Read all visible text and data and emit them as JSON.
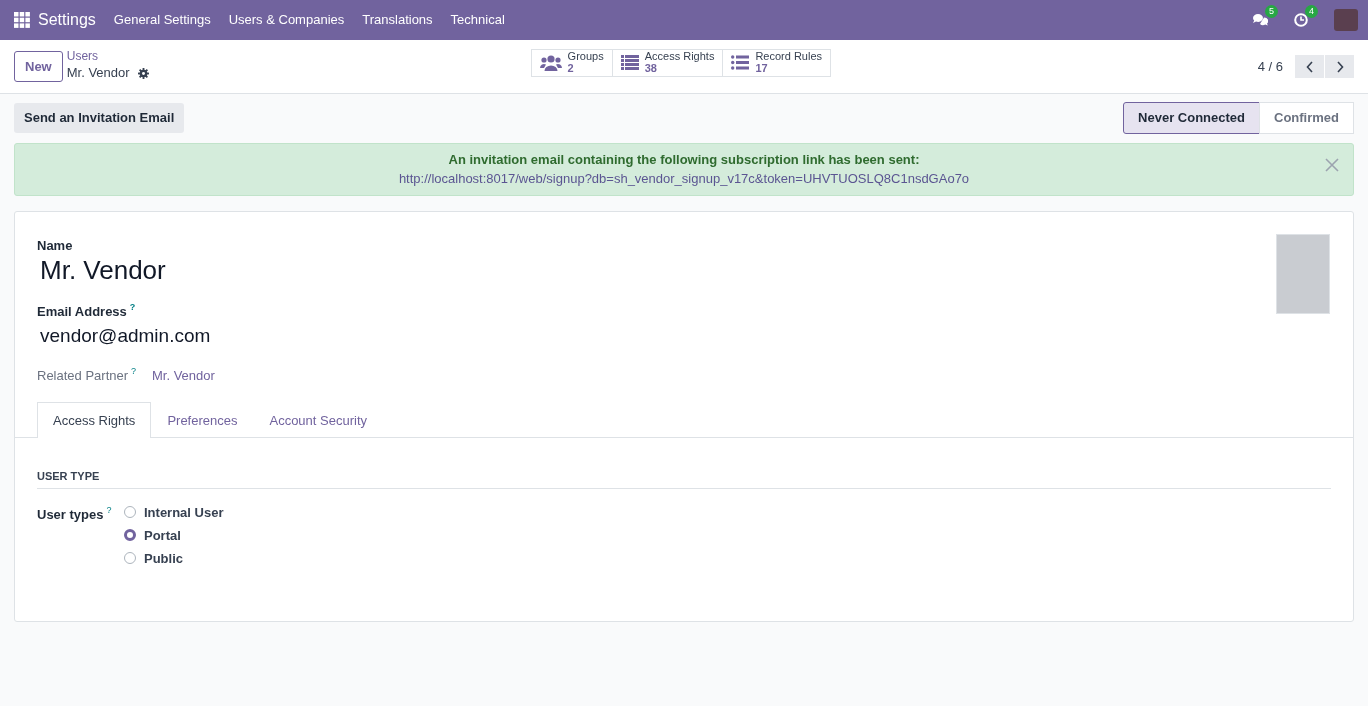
{
  "navbar": {
    "app_title": "Settings",
    "menu": [
      "General Settings",
      "Users & Companies",
      "Translations",
      "Technical"
    ],
    "messages_badge": "5",
    "activities_badge": "4"
  },
  "control_panel": {
    "new_button": "New",
    "breadcrumb": "Users",
    "record_title": "Mr. Vendor",
    "smart_buttons": [
      {
        "kind": "users",
        "label": "Groups",
        "value": "2"
      },
      {
        "kind": "list",
        "label": "Access Rights",
        "value": "38"
      },
      {
        "kind": "bullets",
        "label": "Record Rules",
        "value": "17"
      }
    ],
    "pager": "4 / 6"
  },
  "header": {
    "action_button": "Send an Invitation Email",
    "stages": [
      {
        "label": "Never Connected",
        "selected": true
      },
      {
        "label": "Confirmed",
        "selected": false
      }
    ]
  },
  "alert": {
    "title": "An invitation email containing the following subscription link has been sent:",
    "link": "http://localhost:8017/web/signup?db=sh_vendor_signup_v17c&token=UHVTUOSLQ8C1nsdGAo7o"
  },
  "form": {
    "name_label": "Name",
    "name": "Mr. Vendor",
    "email_label": "Email Address",
    "email_help": "?",
    "email": "vendor@admin.com",
    "partner_label": "Related Partner",
    "partner_help": "?",
    "partner": "Mr. Vendor",
    "tabs": [
      {
        "label": "Access Rights",
        "selected": true
      },
      {
        "label": "Preferences",
        "selected": false
      },
      {
        "label": "Account Security",
        "selected": false
      }
    ],
    "section_title": "USER TYPE",
    "user_types_label": "User types",
    "user_types_help": "?",
    "user_types": [
      {
        "label": "Internal User",
        "selected": false
      },
      {
        "label": "Portal",
        "selected": true
      },
      {
        "label": "Public",
        "selected": false
      }
    ]
  }
}
